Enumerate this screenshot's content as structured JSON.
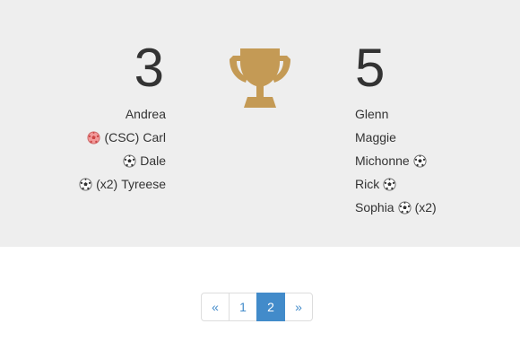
{
  "match": {
    "home": {
      "score": "3",
      "scorers": [
        {
          "name": "Andrea",
          "prefix": "",
          "suffix": "",
          "ball": "none"
        },
        {
          "name": "Carl",
          "prefix": "(CSC)",
          "suffix": "",
          "ball": "own-goal"
        },
        {
          "name": "Dale",
          "prefix": "",
          "suffix": "",
          "ball": "goal"
        },
        {
          "name": "Tyreese",
          "prefix": "(x2)",
          "suffix": "",
          "ball": "goal"
        }
      ]
    },
    "away": {
      "score": "5",
      "scorers": [
        {
          "name": "Glenn",
          "suffix": "",
          "ball": "none"
        },
        {
          "name": "Maggie",
          "suffix": "",
          "ball": "none"
        },
        {
          "name": "Michonne",
          "suffix": "",
          "ball": "goal"
        },
        {
          "name": "Rick",
          "suffix": "",
          "ball": "goal"
        },
        {
          "name": "Sophia",
          "suffix": "(x2)",
          "ball": "goal"
        }
      ]
    },
    "trophy_icon": "trophy-icon",
    "trophy_color": "#c49a55"
  },
  "pagination": {
    "prev_label": "«",
    "pages": [
      "1",
      "2"
    ],
    "active_page": "2",
    "next_label": "»",
    "accent_color": "#428bca"
  }
}
